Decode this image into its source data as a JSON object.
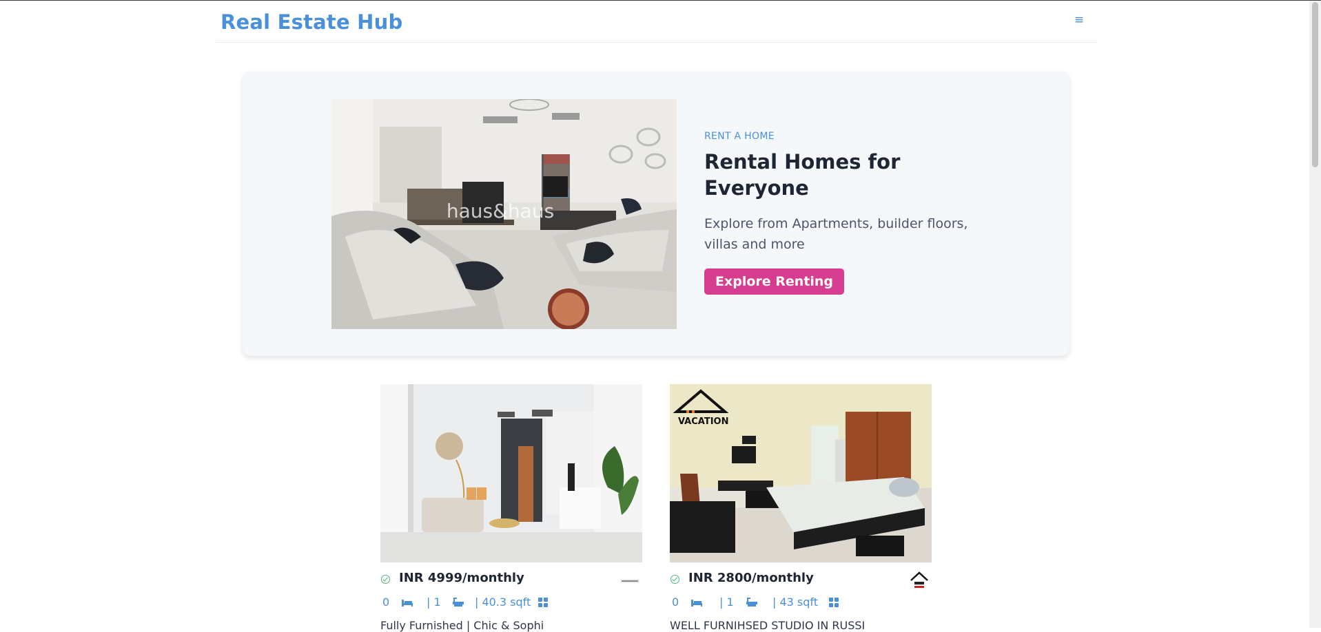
{
  "header": {
    "logo": "Real Estate Hub",
    "menu_icon": "hamburger-icon"
  },
  "hero": {
    "eyebrow": "RENT A HOME",
    "title": "Rental Homes for Everyone",
    "subtitle": "Explore from Apartments, builder floors, villas and more",
    "cta": "Explore Renting",
    "image_watermark": "haus&haus"
  },
  "listings": [
    {
      "price": "INR 4999/monthly",
      "bedrooms": "0",
      "bathrooms": "| 1",
      "area": "| 40.3 sqft",
      "title": "Fully Furnished | Chic & Sophi"
    },
    {
      "price": "INR 2800/monthly",
      "bedrooms": "0",
      "bathrooms": "| 1",
      "area": "| 43 sqft",
      "title": "WELL FURNIHSED STUDIO IN RUSSI",
      "image_logo": "VACATION"
    }
  ],
  "colors": {
    "brand": "#4a90d9",
    "cta": "#d63d8e",
    "check": "#4cb67a"
  }
}
